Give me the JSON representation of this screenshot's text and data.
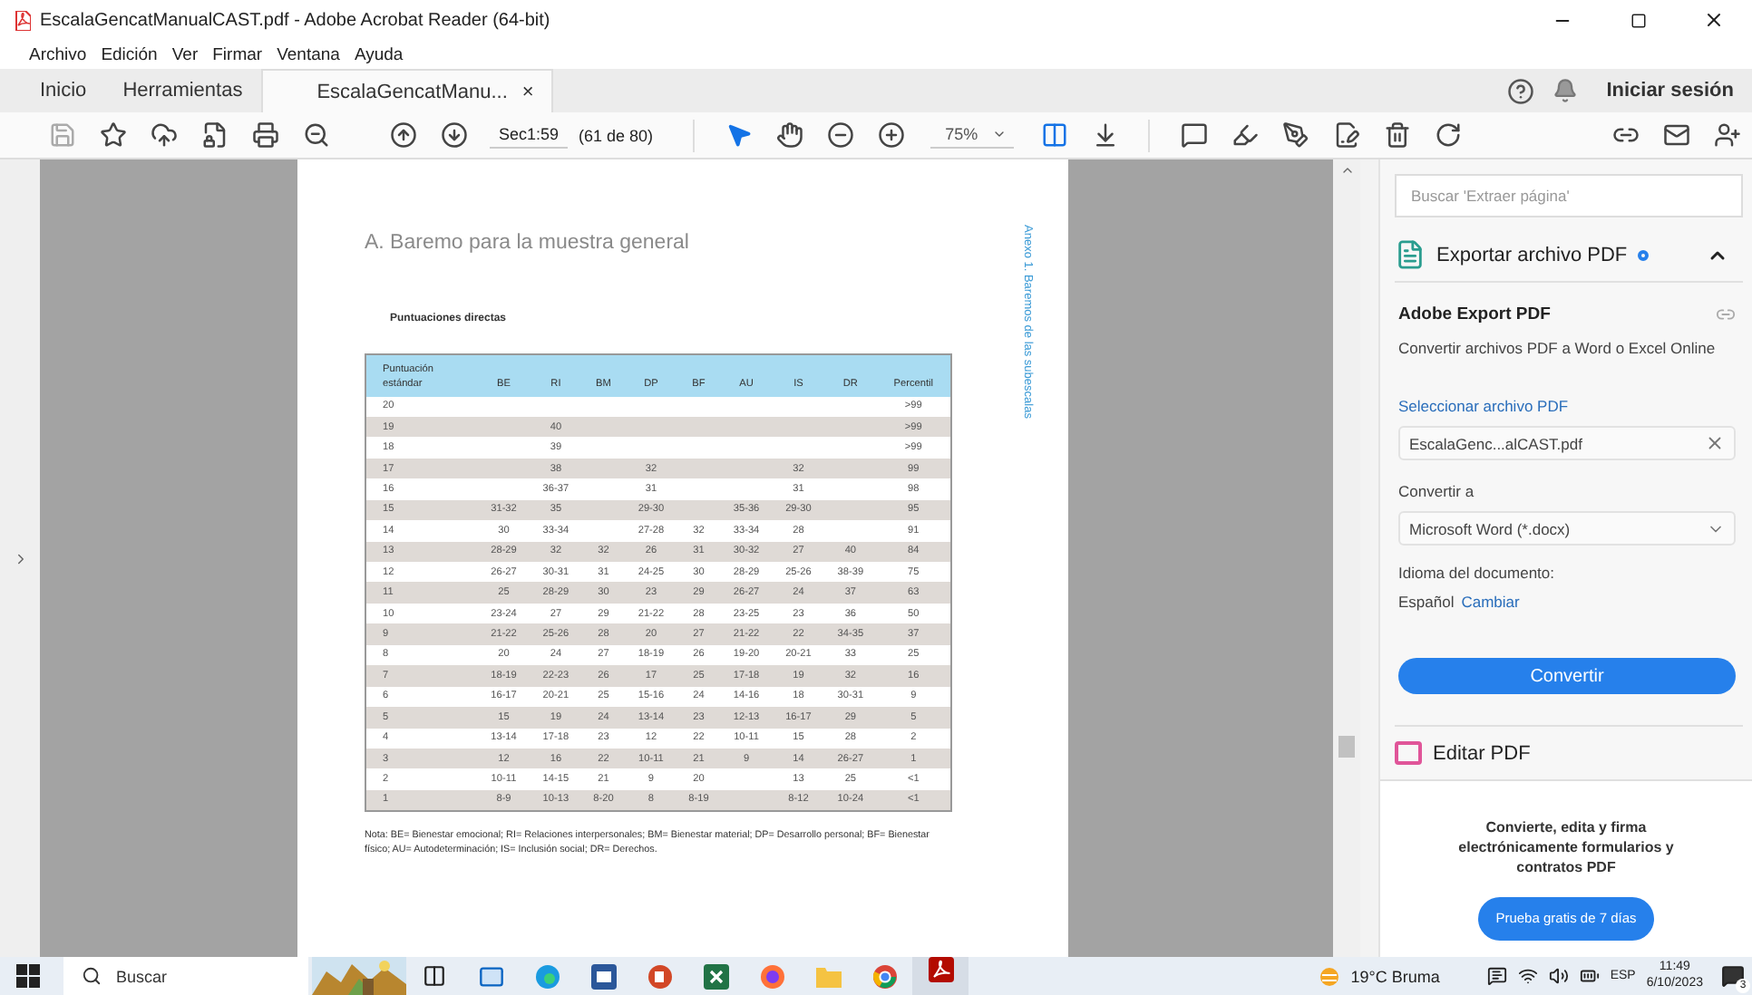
{
  "window": {
    "title": "EscalaGencatManualCAST.pdf - Adobe Acrobat Reader (64-bit)"
  },
  "menu": [
    "Archivo",
    "Edición",
    "Ver",
    "Firmar",
    "Ventana",
    "Ayuda"
  ],
  "tabs": [
    {
      "label": "Inicio",
      "selected": false,
      "closable": false
    },
    {
      "label": "Herramientas",
      "selected": false,
      "closable": false
    },
    {
      "label": "EscalaGencatManu...",
      "selected": true,
      "closable": true
    }
  ],
  "close_glyph": "×",
  "account": {
    "sign_in": "Iniciar sesión"
  },
  "toolbar": {
    "page_field": "Sec1:59",
    "page_count": "(61 de 80)",
    "zoom": "75%"
  },
  "document": {
    "title": "A. Baremo para la muestra general",
    "side_heading": "Anexo 1. Baremos de las subescalas",
    "subtitle": "Puntuaciones directas",
    "table": {
      "columns": [
        "Puntuación estándar",
        "BE",
        "RI",
        "BM",
        "DP",
        "BF",
        "AU",
        "IS",
        "DR",
        "Percentil"
      ],
      "rows": [
        [
          "20",
          "",
          "",
          "",
          "",
          "",
          "",
          "",
          "",
          ">99"
        ],
        [
          "19",
          "",
          "40",
          "",
          "",
          "",
          "",
          "",
          "",
          ">99"
        ],
        [
          "18",
          "",
          "39",
          "",
          "",
          "",
          "",
          "",
          "",
          ">99"
        ],
        [
          "17",
          "",
          "38",
          "",
          "32",
          "",
          "",
          "32",
          "",
          "99"
        ],
        [
          "16",
          "",
          "36-37",
          "",
          "31",
          "",
          "",
          "31",
          "",
          "98"
        ],
        [
          "15",
          "31-32",
          "35",
          "",
          "29-30",
          "",
          "35-36",
          "29-30",
          "",
          "95"
        ],
        [
          "14",
          "30",
          "33-34",
          "",
          "27-28",
          "32",
          "33-34",
          "28",
          "",
          "91"
        ],
        [
          "13",
          "28-29",
          "32",
          "32",
          "26",
          "31",
          "30-32",
          "27",
          "40",
          "84"
        ],
        [
          "12",
          "26-27",
          "30-31",
          "31",
          "24-25",
          "30",
          "28-29",
          "25-26",
          "38-39",
          "75"
        ],
        [
          "11",
          "25",
          "28-29",
          "30",
          "23",
          "29",
          "26-27",
          "24",
          "37",
          "63"
        ],
        [
          "10",
          "23-24",
          "27",
          "29",
          "21-22",
          "28",
          "23-25",
          "23",
          "36",
          "50"
        ],
        [
          "9",
          "21-22",
          "25-26",
          "28",
          "20",
          "27",
          "21-22",
          "22",
          "34-35",
          "37"
        ],
        [
          "8",
          "20",
          "24",
          "27",
          "18-19",
          "26",
          "19-20",
          "20-21",
          "33",
          "25"
        ],
        [
          "7",
          "18-19",
          "22-23",
          "26",
          "17",
          "25",
          "17-18",
          "19",
          "32",
          "16"
        ],
        [
          "6",
          "16-17",
          "20-21",
          "25",
          "15-16",
          "24",
          "14-16",
          "18",
          "30-31",
          "9"
        ],
        [
          "5",
          "15",
          "19",
          "24",
          "13-14",
          "23",
          "12-13",
          "16-17",
          "29",
          "5"
        ],
        [
          "4",
          "13-14",
          "17-18",
          "23",
          "12",
          "22",
          "10-11",
          "15",
          "28",
          "2"
        ],
        [
          "3",
          "12",
          "16",
          "22",
          "10-11",
          "21",
          "9",
          "14",
          "26-27",
          "1"
        ],
        [
          "2",
          "10-11",
          "14-15",
          "21",
          "9",
          "20",
          "",
          "13",
          "25",
          "<1"
        ],
        [
          "1",
          "8-9",
          "10-13",
          "8-20",
          "8",
          "8-19",
          "",
          "8-12",
          "10-24",
          "<1"
        ]
      ]
    },
    "note": "Nota: BE= Bienestar emocional; RI= Relaciones interpersonales; BM= Bienestar material; DP= Desarrollo personal; BF= Bienestar físico; AU= Autodeterminación; IS= Inclusión social; DR= Derechos."
  },
  "right_panel": {
    "search": {
      "placeholder": "Buscar 'Extraer página'"
    },
    "section": {
      "title": "Exportar archivo PDF",
      "expanded": true
    },
    "heading": "Adobe Export PDF",
    "description": "Convertir archivos PDF a Word o Excel Online",
    "select_label": "Seleccionar archivo PDF",
    "file": "EscalaGenc...alCAST.pdf",
    "convert_label": "Convertir a",
    "format": "Microsoft Word (*.docx)",
    "language_label": "Idioma del documento:",
    "language": "Español",
    "change_link": "Cambiar",
    "convert_button": "Convertir",
    "next_section": "Editar PDF",
    "promo": "Convierte, edita y firma electrónicamente formularios y contratos PDF",
    "trial_button": "Prueba gratis de 7 días"
  },
  "taskbar": {
    "search": "Buscar",
    "weather": "19°C Bruma",
    "language": "ESP",
    "time": "11:49",
    "date": "6/10/2023",
    "notifications": "3"
  }
}
